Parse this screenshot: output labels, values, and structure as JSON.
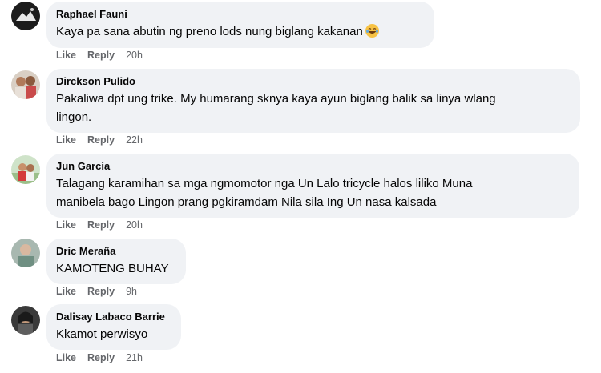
{
  "actions": {
    "like": "Like",
    "reply": "Reply"
  },
  "comments": [
    {
      "author": "Raphael Fauni",
      "text": "Kaya pa sana abutin ng preno lods nung biglang kakanan",
      "emoji": "laughing-tears-emoji",
      "time": "20h"
    },
    {
      "author": "Dirckson Pulido",
      "text_lines": [
        "Pakaliwa dpt ung trike. My humarang sknya kaya ayun biglang balik sa linya wlang",
        "lingon."
      ],
      "time": "22h"
    },
    {
      "author": "Jun Garcia",
      "text_lines": [
        "Talagang karamihan sa mga ngmomotor nga Un Lalo tricycle halos liliko Muna",
        "manibela bago Lingon prang pgkiramdam Nila sila Ing Un nasa kalsada"
      ],
      "time": "20h"
    },
    {
      "author": "Dric Meraña",
      "text": "KAMOTENG BUHAY",
      "time": "9h"
    },
    {
      "author": "Dalisay Labaco Barrie",
      "text": "Kkamot perwisyo",
      "time": "21h"
    }
  ],
  "colors": {
    "bubble": "#f0f2f5",
    "meta": "#65676b",
    "text": "#050505"
  }
}
